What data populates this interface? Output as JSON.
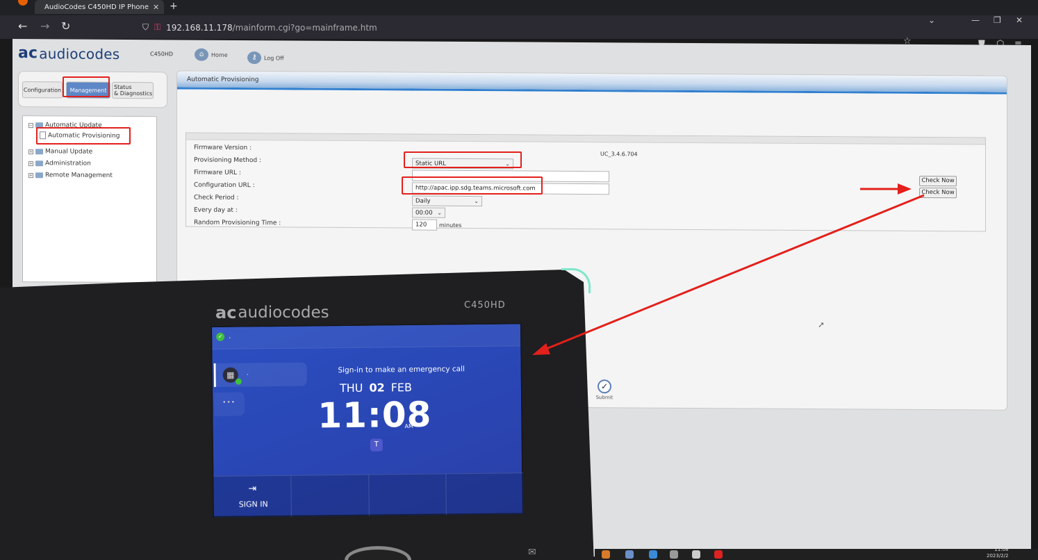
{
  "browser": {
    "tab_title": "AudioCodes C450HD IP Phone",
    "url_host": "192.168.11.178",
    "url_path": "/mainform.cgi?go=mainframe.htm"
  },
  "header": {
    "logo": "audiocodes",
    "model": "C450HD",
    "home_label": "Home",
    "logoff_label": "Log Off"
  },
  "tabs": {
    "configuration": "Configuration",
    "management": "Management",
    "status_1": "Status",
    "status_2": "& Diagnostics"
  },
  "tree": {
    "automatic_update": "Automatic Update",
    "automatic_provisioning": "Automatic Provisioning",
    "manual_update": "Manual Update",
    "administration": "Administration",
    "remote_management": "Remote Management"
  },
  "panel": {
    "title": "Automatic Provisioning",
    "firmware_version_label": "Firmware Version :",
    "firmware_version_value": "UC_3.4.6.704",
    "provisioning_method_label": "Provisioning Method :",
    "provisioning_method_value": "Static URL",
    "firmware_url_label": "Firmware URL :",
    "firmware_url_value": "",
    "configuration_url_label": "Configuration URL :",
    "configuration_url_value": "http://apac.ipp.sdg.teams.microsoft.com",
    "check_period_label": "Check Period :",
    "check_period_value": "Daily",
    "every_day_label": "Every day at :",
    "every_day_value": "00:00",
    "random_time_label": "Random Provisioning Time :",
    "random_time_value": "120",
    "random_time_unit": "minutes",
    "check_now_1": "Check Now",
    "check_now_2": "Check Now",
    "submit": "Submit"
  },
  "phone": {
    "brand": "audiocodes",
    "model": "C450HD",
    "status_dot": ".",
    "line_dot": ".",
    "more": "•••",
    "emergency_text": "Sign-in to make an emergency call",
    "weekday": "THU",
    "day": "02",
    "month": "FEB",
    "time": "11:08",
    "ampm": "AM",
    "softkey_1": "SIGN IN"
  },
  "taskbar": {
    "time": "11:08",
    "date": "2023/2/2"
  },
  "colors": {
    "highlight_red": "#e3201b",
    "phone_screen_blue": "#2b4fc1",
    "panel_header_blue": "#2f7fd0"
  },
  "icons": [
    "firefox-icon",
    "close-icon",
    "plus-icon",
    "back-arrow-icon",
    "forward-arrow-icon",
    "reload-icon",
    "shield-icon",
    "lock-icon",
    "star-icon",
    "pocket-icon",
    "extensions-icon",
    "menu-icon",
    "home-icon",
    "key-icon",
    "folder-icon",
    "page-icon",
    "checkmark-icon",
    "calculator-icon",
    "teams-icon",
    "sign-in-icon",
    "mail-icon"
  ]
}
